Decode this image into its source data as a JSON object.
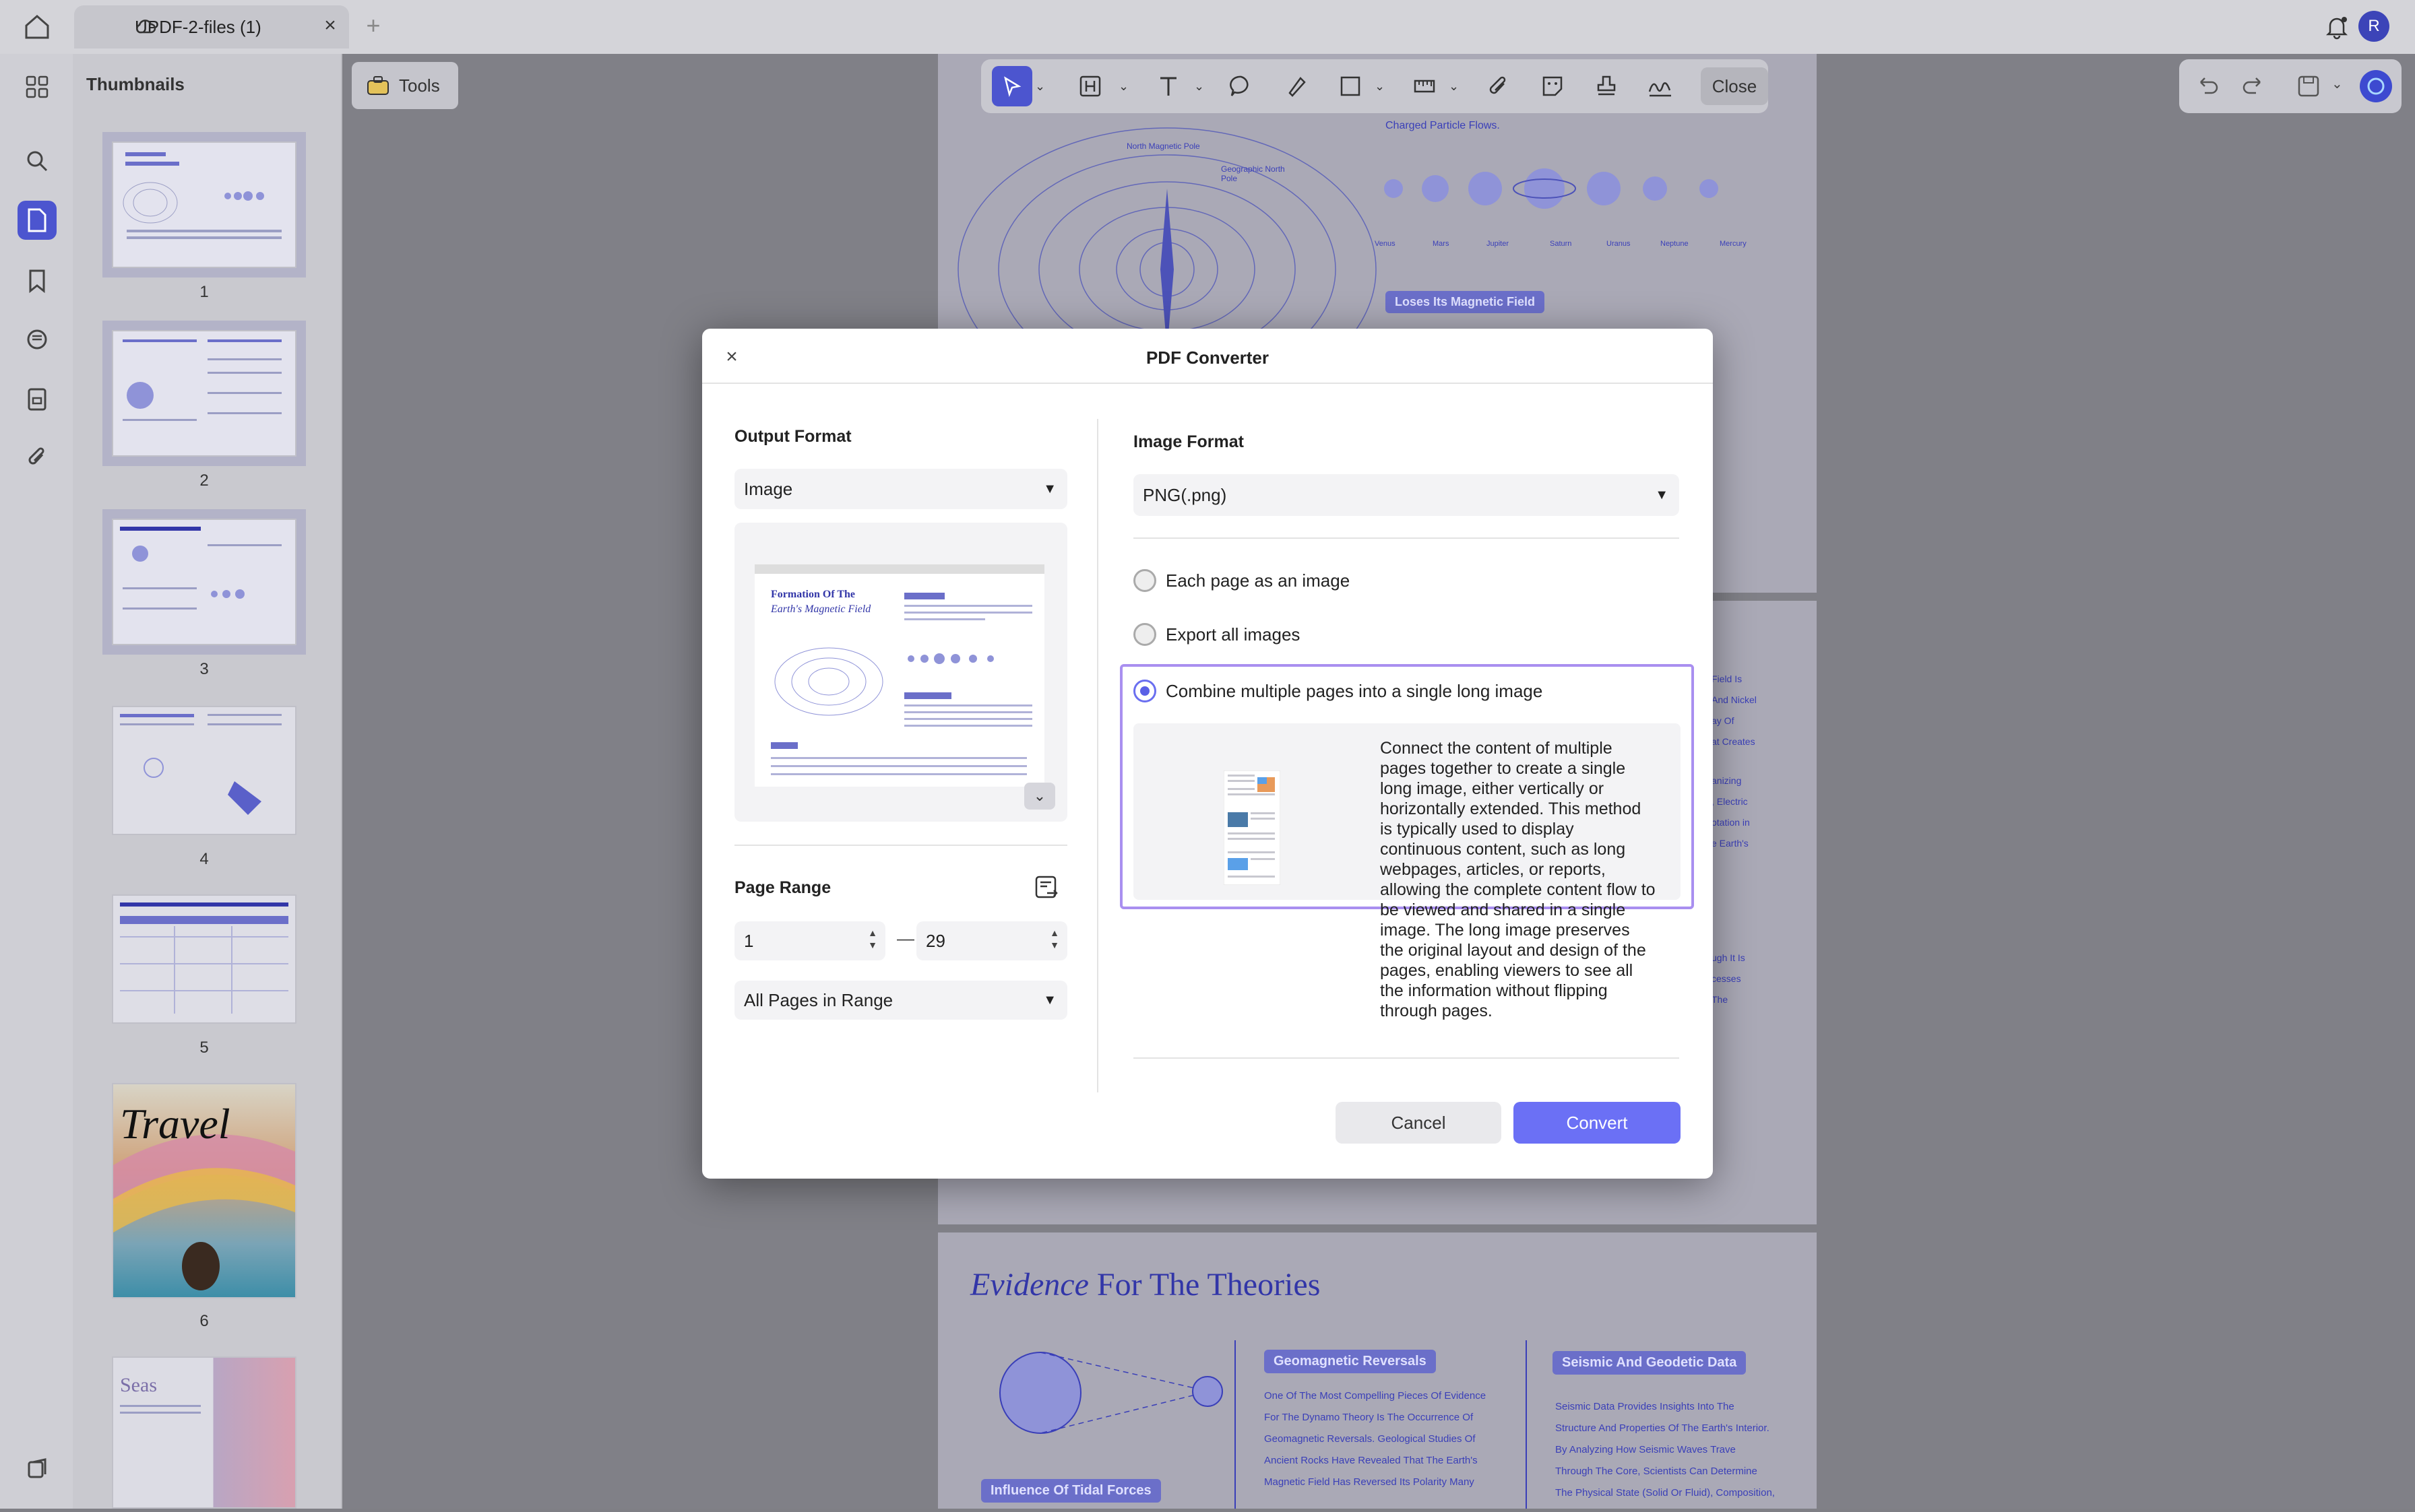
{
  "window": {
    "tab_title": "UPDF-2-files (1)",
    "avatar_initial": "R"
  },
  "sidebar": {
    "title": "Thumbnails",
    "tools_label": "Tools",
    "pages": [
      "1",
      "2",
      "3",
      "4",
      "5",
      "6"
    ]
  },
  "toolbar": {
    "close_label": "Close"
  },
  "document": {
    "page1_caption": "Charged Particle Flows.",
    "page1_north_magnetic": "North Magnetic Pole",
    "page1_geographic_north": "Geographic North Pole",
    "planets": [
      "Venus",
      "Mars",
      "Jupiter",
      "Saturn",
      "Uranus",
      "Neptune",
      "Mercury"
    ],
    "page1_badge": "Loses Its Magnetic Field",
    "page2_snippets": [
      "Field Is",
      "And Nickel",
      "ay Of",
      "at Creates",
      "anizing",
      ", Electric",
      "otation in",
      "e Earth's",
      "ugh It Is",
      "cesses",
      "The"
    ],
    "page3_heading_italic": "Evidence",
    "page3_heading_rest": " For The Theories",
    "page3_badge_1": "Geomagnetic Reversals",
    "page3_badge_2": "Seismic And Geodetic Data",
    "page3_badge_3": "Influence Of Tidal Forces",
    "page3_text_1": [
      "One Of The Most Compelling Pieces Of Evidence",
      "For The Dynamo Theory Is The Occurrence Of",
      "Geomagnetic Reversals. Geological Studies Of",
      "Ancient Rocks Have Revealed That The Earth's",
      "Magnetic Field Has Reversed Its Polarity Many"
    ],
    "page3_text_2": [
      "Seismic Data Provides Insights Into The",
      "Structure And Properties Of The Earth's Interior.",
      "By Analyzing How Seismic Waves Trave",
      "Through The Core, Scientists Can Determine",
      "The Physical State (Solid Or Fluid), Composition,"
    ]
  },
  "dialog": {
    "title": "PDF Converter",
    "output_format_label": "Output Format",
    "output_format_value": "Image",
    "preview_title_line1": "Formation Of The",
    "preview_title_line2": "Earth's Magnetic Field",
    "page_range_label": "Page Range",
    "range_from": "1",
    "range_separator": "—",
    "range_to": "29",
    "range_mode": "All Pages in Range",
    "image_format_label": "Image Format",
    "image_format_value": "PNG(.png)",
    "options": [
      {
        "label": "Each page as an image",
        "selected": false
      },
      {
        "label": "Export all images",
        "selected": false
      },
      {
        "label": "Combine multiple pages into a single long image",
        "selected": true
      }
    ],
    "description": "Connect the content of multiple pages together to create a single long image, either vertically or horizontally extended. This method is typically used to display continuous content, such as long webpages, articles, or reports, allowing the complete content flow to be viewed and shared in a single image. The long image preserves the original layout and design of the pages, enabling viewers to see all the information without flipping through pages.",
    "cancel_label": "Cancel",
    "convert_label": "Convert"
  },
  "colors": {
    "accent": "#6b70f5",
    "rail_active": "#4c55cf",
    "selection_border": "#a98ff0"
  }
}
